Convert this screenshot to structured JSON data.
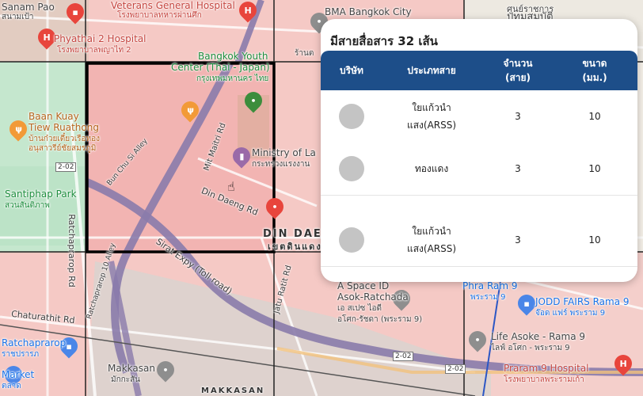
{
  "panel": {
    "title": "มีสายสื่อสาร 32 เส้น",
    "columns": [
      {
        "label": "บริษัท",
        "sortable": false
      },
      {
        "label": "ประเภทสาย",
        "sortable": false
      },
      {
        "label": "จำนวน (สาย)",
        "sortable": true
      },
      {
        "label": "ขนาด (มม.)",
        "sortable": true
      }
    ],
    "rows": [
      {
        "company_logo": "company-logo",
        "type": "ใยแก้วนำแสง(ARSS)",
        "count": "3",
        "size": "10"
      },
      {
        "company_logo": "company-logo",
        "type": "ทองแดง",
        "count": "3",
        "size": "10"
      },
      {
        "company_logo": "company-logo",
        "type": "ใยแก้วนำแสง(ARSS)",
        "count": "3",
        "size": "10"
      }
    ],
    "header_color": "#1d4e89"
  },
  "map": {
    "selected_tile_color": "#f4a6a6",
    "labels": {
      "sanam_pao": "Sanam Pao",
      "sanam_pao_th": "สนามเป้า",
      "veterans": "Veterans General Hospital",
      "veterans_th": "โรงพยาบาลทหารผ่านศึก",
      "bma": "BMA Bangkok City",
      "bma_th": "ร้านต",
      "phyathai": "Phyathai 2 Hospital",
      "phyathai_th": "โรงพยาบาลพญาไท 2",
      "bangkok_youth": "Bangkok Youth",
      "center_japan": "Center (Thai - Japan)",
      "center_th": "กรุงเทพมหานคร ไทย",
      "baan_kuay": "Baan Kuay",
      "tiew_ruathong": "Tiew Ruathong",
      "baan_kuay_th1": "บ้านก๋วยเตี๋ยวเรือทอง",
      "baan_kuay_th2": "อนุสาวรีย์ชัยสมรภูมิ",
      "ministry": "Ministry of La",
      "ministry_th": "กระทรวงแรงงาน",
      "bun_chu_si": "Bun Chu Si Alley",
      "mit_maitri": "Mit Maitri Rd",
      "din_daeng_rd": "Din Daeng Rd",
      "route_202a": "2-02",
      "santiphap": "Santiphap Park",
      "santiphap_th": "สวนสันติภาพ",
      "ratchaprarop_rd": "Ratchaprarop Rd",
      "din_daeng_district": "DIN DAE",
      "din_daeng_district_th": "เขตดินแดง",
      "alley": "Alley",
      "sirat_expy": "Sirat Expy (Toll road)",
      "soi_ratchaprarop": "Ratchaprarop 10 Alley",
      "jatu_ratit": "Jatu Ratit Rd",
      "a_space": "A Space ID",
      "a_space_2": "Asok-Ratchada",
      "a_space_th": "เอ สเปซ ไอดี",
      "a_space_th2": "อโศก-รัชดา (พระราม 9)",
      "chaturathit": "Chaturathit Rd",
      "ratchaprarop": "Ratchaprarop",
      "ratchaprarop_th": "ราชปรารภ",
      "life_asoke": "Life Asoke - Rama 9",
      "life_asoke_th": "ไลฟ์ อโศก - พระราม 9",
      "phra_ram9": "Phra Ram 9",
      "phra_ram9_th": "พระราม 9",
      "jodd": "JODD FAIRS Rama 9",
      "jodd_th": "จ๊อด แฟร์ พระราม 9",
      "route_202b": "2-02",
      "route_202c": "2-02",
      "praram9_hosp": "Praram 9 Hospital",
      "praram9_hosp_th": "โรงพยาบาลพระรามเก้า",
      "market": "Market",
      "market_th": "ตลาด",
      "makkasan": "Makkasan",
      "makkasan_th": "มักกะสัน",
      "makkasan_district": "MAKKASAN",
      "pathum_th": "ปทุมสมบัติ",
      "pathum_top": "ศูนย์ราชการ"
    }
  }
}
